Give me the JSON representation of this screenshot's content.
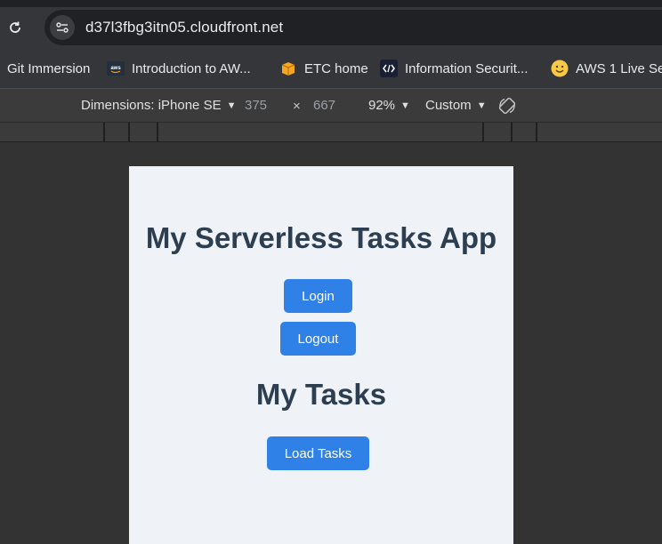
{
  "browser": {
    "url": "d37l3fbg3itn05.cloudfront.net",
    "bookmarks": [
      {
        "label": "Git Immersion",
        "icon": "none"
      },
      {
        "label": "Introduction to AW...",
        "icon": "aws-logo-icon"
      },
      {
        "label": "ETC home",
        "icon": "package-icon"
      },
      {
        "label": "Information Securit...",
        "icon": "code-icon"
      },
      {
        "label": "AWS 1 Live Ses",
        "icon": "smiley-icon"
      }
    ]
  },
  "devtools": {
    "dimensions_label": "Dimensions: iPhone SE",
    "width": "375",
    "times": "×",
    "height": "667",
    "zoom": "92%",
    "throttle": "Custom"
  },
  "app": {
    "title": "My Serverless Tasks App",
    "login_label": "Login",
    "logout_label": "Logout",
    "tasks_heading": "My Tasks",
    "load_tasks_label": "Load Tasks"
  },
  "colors": {
    "button": "#2f80e7",
    "heading": "#2c3e50",
    "viewport_bg": "#eff3f8"
  }
}
